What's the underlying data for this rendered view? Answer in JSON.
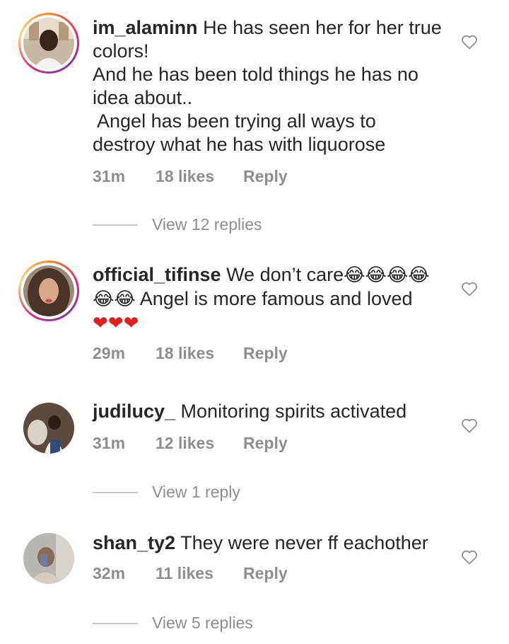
{
  "comments": [
    {
      "username": "im_alaminn",
      "lines": [
        "He has seen her for her true",
        "colors!",
        "And he has been told things he has no",
        "idea about..",
        " Angel has been trying all ways to",
        "destroy what he has with liquorose"
      ],
      "time": "31m",
      "likes": "18 likes",
      "reply": "Reply",
      "view_replies": "View 12 replies",
      "avatar_ring": true
    },
    {
      "username": "official_tifinse",
      "text_part1": "We don’t care",
      "emoji_laugh": "😂😂😂😂",
      "emoji_laugh2": "😂😂",
      "text_part2": "Angel is more famous and loved",
      "emoji_hearts": "❤❤❤",
      "time": "29m",
      "likes": "18 likes",
      "reply": "Reply",
      "avatar_ring": true
    },
    {
      "username": "judilucy_",
      "text": "Monitoring spirits activated",
      "time": "31m",
      "likes": "12 likes",
      "reply": "Reply",
      "view_replies": "View 1 reply",
      "avatar_ring": false
    },
    {
      "username": "shan_ty2",
      "text": "They were never ff eachother",
      "time": "32m",
      "likes": "11 likes",
      "reply": "Reply",
      "view_replies": "View 5 replies",
      "avatar_ring": false
    }
  ],
  "icons": {
    "like": "heart-outline-icon"
  },
  "colors": {
    "text": "#262626",
    "muted": "#8e8e8e",
    "emoji_heart": "#e0201f"
  }
}
